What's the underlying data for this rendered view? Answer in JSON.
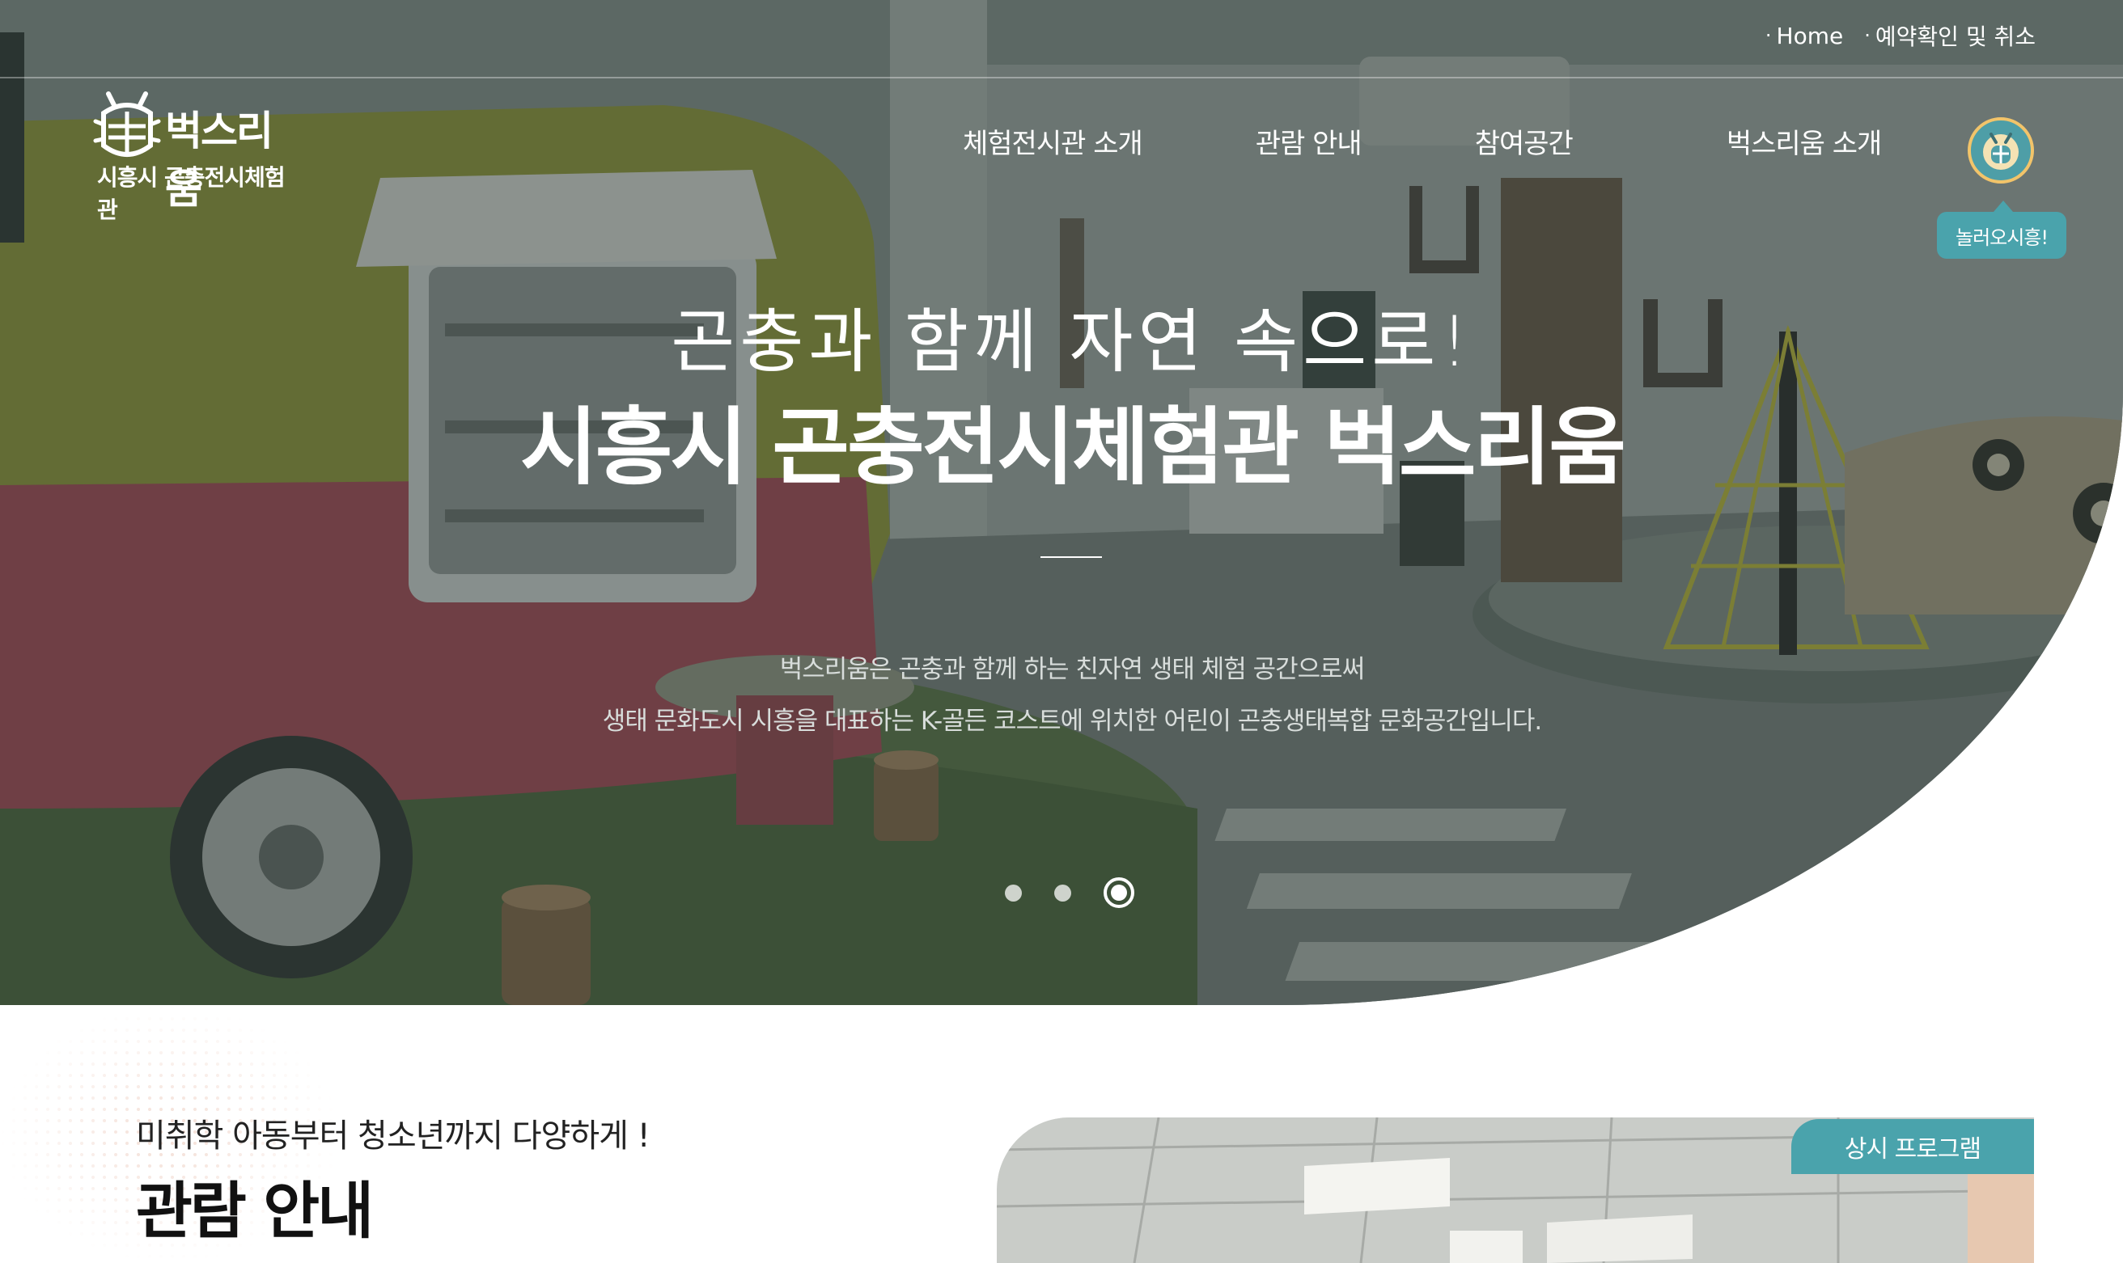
{
  "top_links": [
    {
      "label": "Home"
    },
    {
      "label": "예약확인 및 취소"
    }
  ],
  "logo": {
    "title": "벅스리움",
    "subtitle": "시흥시 곤충전시체험관"
  },
  "gnb": [
    {
      "label": "체험전시관 소개"
    },
    {
      "label": "관람 안내"
    },
    {
      "label": "참여공간"
    },
    {
      "label": "벅스리움 소개"
    }
  ],
  "mascot": {
    "icon": "mascot-icon",
    "tooltip": "놀러오시흥!"
  },
  "hero": {
    "line1": "곤충과 함께 자연 속으로!",
    "line2": "시흥시 곤충전시체험관 벅스리움",
    "desc1": "벅스리움은 곤충과 함께 하는 친자연 생태 체험 공간으로써",
    "desc2": "생태 문화도시 시흥을 대표하는 K-골든 코스트에 위치한 어린이 곤충생태복합 문화공간입니다.",
    "slides": 3,
    "active_slide": 3
  },
  "guide": {
    "kicker": "미취학 아동부터 청소년까지 다양하게 !",
    "title": "관람 안내"
  },
  "program": {
    "badge": "상시 프로그램"
  },
  "colors": {
    "accent": "#4aa3ac",
    "mascot_ring": "#f2c46a",
    "overlay": "#28342f"
  }
}
